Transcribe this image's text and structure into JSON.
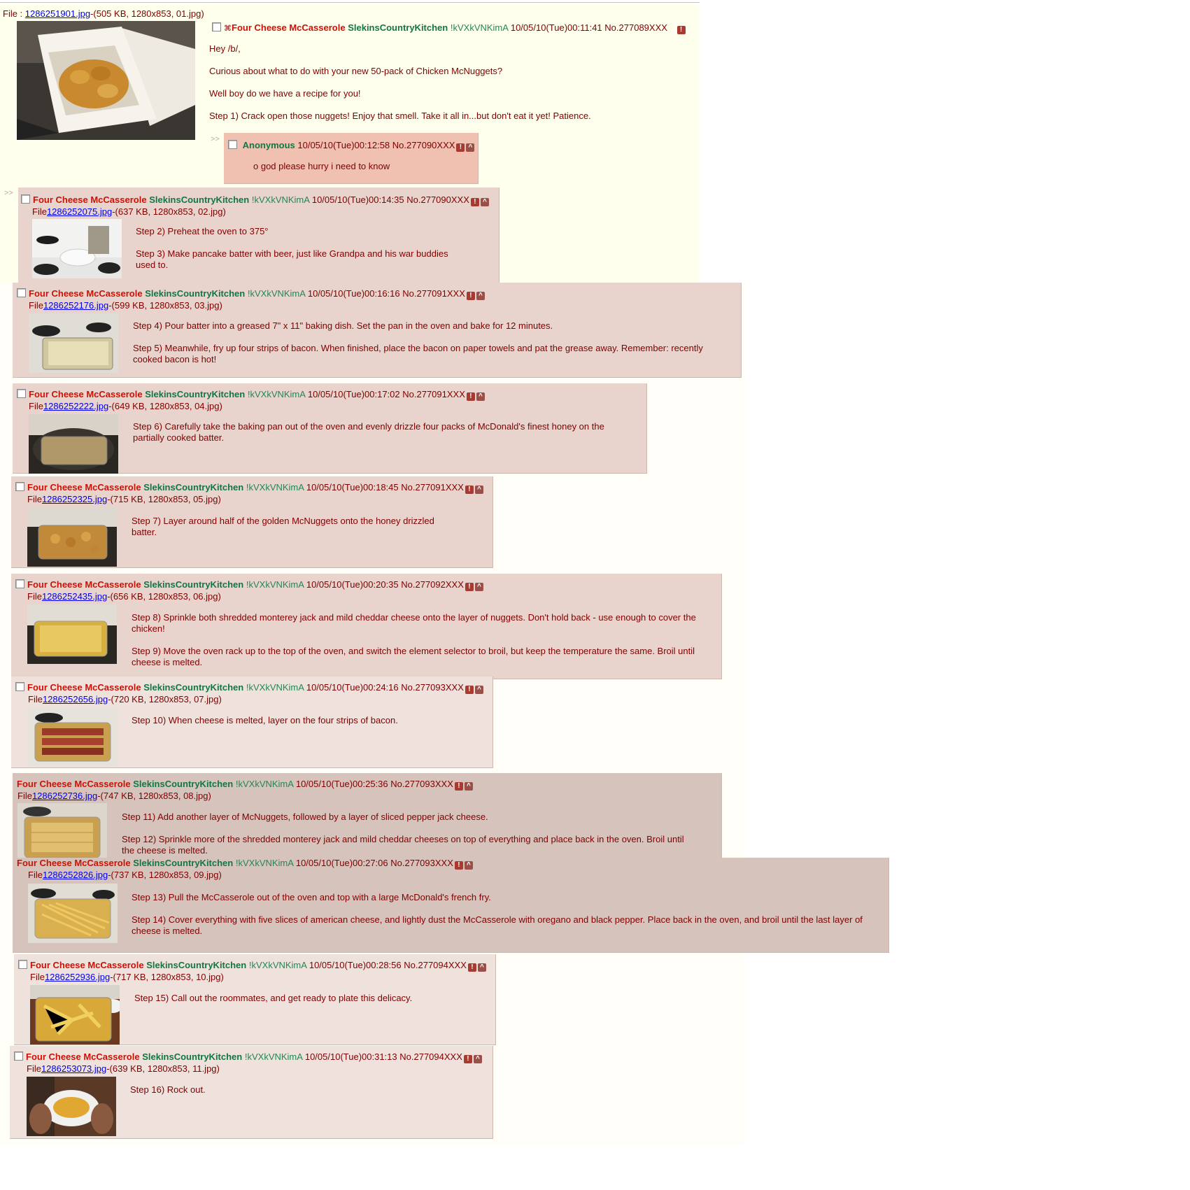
{
  "op": {
    "file_label": "File :",
    "file_link": "1286251901.jpg",
    "file_meta": "-(505 KB, 1280x853, 01.jpg)",
    "subject": "Four Cheese McCasserole",
    "name": "SlekinsCountryKitchen",
    "trip": "!kVXkVNKimA",
    "datetime": "10/05/10(Tue)00:11:41",
    "number": "No.277089XXX",
    "lines": [
      "Hey /b/,",
      "Curious about what to do with your new 50-pack of Chicken McNuggets?",
      "Well boy do we have a recipe for you!",
      "Step 1) Crack open those nuggets! Enjoy that smell. Take it all in...but don't eat it yet! Patience."
    ]
  },
  "reply_anon": {
    "arrow": ">>",
    "name": "Anonymous",
    "datetime": "10/05/10(Tue)00:12:58",
    "number": "No.277090XXX",
    "text": "o god please hurry i need to know"
  },
  "common": {
    "subject": "Four Cheese McCasserole",
    "name": "SlekinsCountryKitchen",
    "trip": "!kVXkVNKimA",
    "file_label": "File",
    "report_icon": "!",
    "up_icon": "^",
    "arrow": ">>"
  },
  "posts": [
    {
      "datetime": "10/05/10(Tue)00:14:35",
      "number": "No.277090XXX",
      "file_link": "1286252075.jpg",
      "file_meta": "-(637 KB, 1280x853, 02.jpg)",
      "lines": [
        "Step 2) Preheat the oven to 375°",
        "Step 3) Make pancake batter with beer, just like Grandpa and his war buddies used to."
      ]
    },
    {
      "datetime": "10/05/10(Tue)00:16:16",
      "number": "No.277091XXX",
      "file_link": "1286252176.jpg",
      "file_meta": "-(599 KB, 1280x853, 03.jpg)",
      "lines": [
        "Step 4) Pour batter into a greased 7\" x 11\" baking dish. Set the pan in the oven and bake for 12 minutes.",
        "Step 5) Meanwhile, fry up four strips of bacon. When finished, place the bacon on paper towels and pat the grease away. Remember: recently cooked bacon is hot!"
      ]
    },
    {
      "datetime": "10/05/10(Tue)00:17:02",
      "number": "No.277091XXX",
      "file_link": "1286252222.jpg",
      "file_meta": "-(649 KB, 1280x853, 04.jpg)",
      "lines": [
        "Step 6) Carefully take the baking pan out of the oven and evenly drizzle four packs of McDonald's finest honey on the partially cooked batter."
      ]
    },
    {
      "datetime": "10/05/10(Tue)00:18:45",
      "number": "No.277091XXX",
      "file_link": "1286252325.jpg",
      "file_meta": "-(715 KB, 1280x853, 05.jpg)",
      "lines": [
        "Step 7) Layer around half of the golden McNuggets onto the honey drizzled batter."
      ]
    },
    {
      "datetime": "10/05/10(Tue)00:20:35",
      "number": "No.277092XXX",
      "file_link": "1286252435.jpg",
      "file_meta": "-(656 KB, 1280x853, 06.jpg)",
      "lines": [
        "Step 8) Sprinkle both shredded monterey jack and mild cheddar cheese onto the layer of nuggets. Don't hold back - use enough to cover the chicken!",
        "Step 9) Move the oven rack up to the top of the oven, and switch the element selector to broil, but keep the temperature the same. Broil until cheese is melted."
      ]
    },
    {
      "datetime": "10/05/10(Tue)00:24:16",
      "number": "No.277093XXX",
      "file_link": "1286252656.jpg",
      "file_meta": "-(720 KB, 1280x853, 07.jpg)",
      "lines": [
        "Step 10) When cheese is melted, layer on the four strips of bacon."
      ]
    },
    {
      "datetime": "10/05/10(Tue)00:25:36",
      "number": "No.277093XXX",
      "file_link": "1286252736.jpg",
      "file_meta": "-(747 KB, 1280x853, 08.jpg)",
      "lines": [
        "Step 11) Add another layer of McNuggets, followed by a layer of sliced pepper jack cheese.",
        "Step 12) Sprinkle more of the shredded monterey jack and mild cheddar cheeses on top of everything and place back in the oven. Broil until the cheese is melted."
      ]
    },
    {
      "datetime": "10/05/10(Tue)00:27:06",
      "number": "No.277093XXX",
      "file_link": "1286252826.jpg",
      "file_meta": "-(737 KB, 1280x853, 09.jpg)",
      "lines": [
        "Step 13) Pull the McCasserole out of the oven and top with a large McDonald's french fry.",
        "Step 14) Cover everything with five slices of american cheese, and lightly dust the McCasserole with oregano and black pepper. Place back in the oven, and broil until the last layer of cheese is melted."
      ]
    },
    {
      "datetime": "10/05/10(Tue)00:28:56",
      "number": "No.277094XXX",
      "file_link": "1286252936.jpg",
      "file_meta": "-(717 KB, 1280x853, 10.jpg)",
      "lines": [
        "Step 15) Call out the roommates, and get ready to plate this delicacy."
      ]
    },
    {
      "datetime": "10/05/10(Tue)00:31:13",
      "number": "No.277094XXX",
      "file_link": "1286253073.jpg",
      "file_meta": "-(639 KB, 1280x853, 11.jpg)",
      "lines": [
        "Step 16) Rock out."
      ]
    }
  ]
}
